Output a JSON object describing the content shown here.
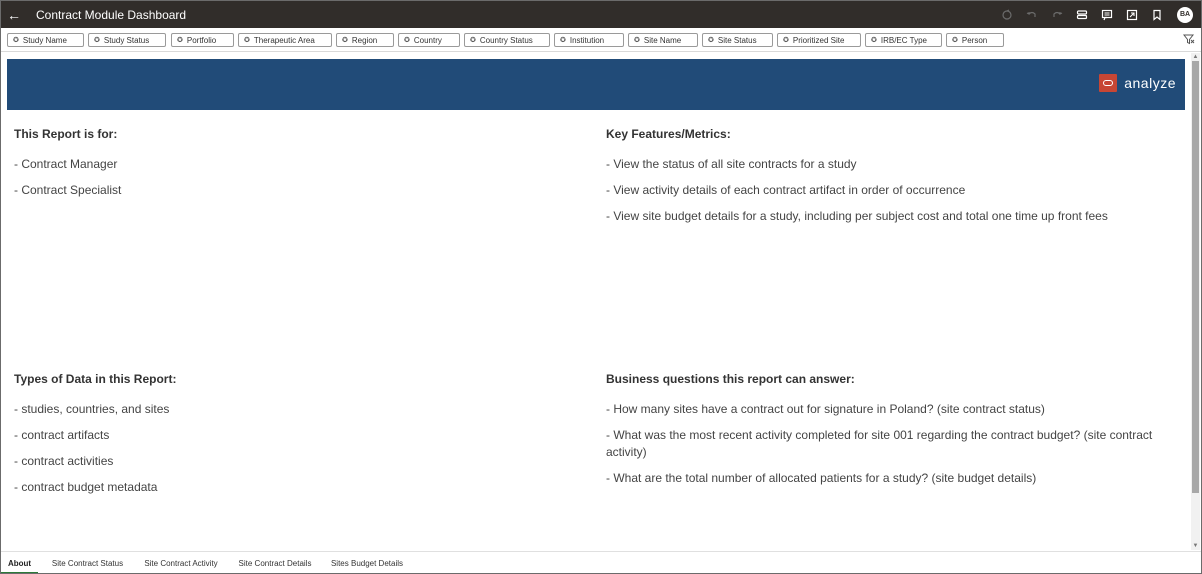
{
  "titlebar": {
    "back_icon": "back-arrow-icon",
    "title": "Contract Module Dashboard",
    "avatar_initials": "BA"
  },
  "filters": [
    {
      "label": "Study Name"
    },
    {
      "label": "Study Status"
    },
    {
      "label": "Portfolio"
    },
    {
      "label": "Therapeutic Area"
    },
    {
      "label": "Region"
    },
    {
      "label": "Country"
    },
    {
      "label": "Country Status"
    },
    {
      "label": "Institution"
    },
    {
      "label": "Site Name"
    },
    {
      "label": "Site Status"
    },
    {
      "label": "Prioritized Site"
    },
    {
      "label": "IRB/EC Type"
    },
    {
      "label": "Person"
    }
  ],
  "banner": {
    "brand_text": "analyze",
    "color": "#214b78",
    "logo_color": "#c74634"
  },
  "report_for": {
    "heading": "This Report is for:",
    "items": [
      "- Contract Manager",
      "- Contract Specialist"
    ]
  },
  "key_features": {
    "heading": "Key Features/Metrics:",
    "items": [
      "- View the status of all site contracts for a study",
      "- View activity details of each contract artifact in order of occurrence",
      "- View site budget details for a study, including per subject cost and total one time up front fees"
    ]
  },
  "data_types": {
    "heading": "Types of Data in this Report:",
    "items": [
      "- studies, countries, and sites",
      "- contract artifacts",
      "- contract activities",
      "- contract budget metadata"
    ]
  },
  "business_questions": {
    "heading": "Business questions this report can answer:",
    "items": [
      "- How many sites have a contract out for signature in Poland? (site contract status)",
      "- What was the most recent activity completed for site 001 regarding the contract budget? (site contract activity)",
      "- What are the total number of allocated patients for a study? (site budget details)"
    ]
  },
  "tabs": [
    {
      "label": "About",
      "active": true
    },
    {
      "label": "Site Contract Status",
      "active": false
    },
    {
      "label": "Site Contract Activity",
      "active": false
    },
    {
      "label": "Site Contract Details",
      "active": false
    },
    {
      "label": "Sites Budget Details",
      "active": false
    }
  ]
}
